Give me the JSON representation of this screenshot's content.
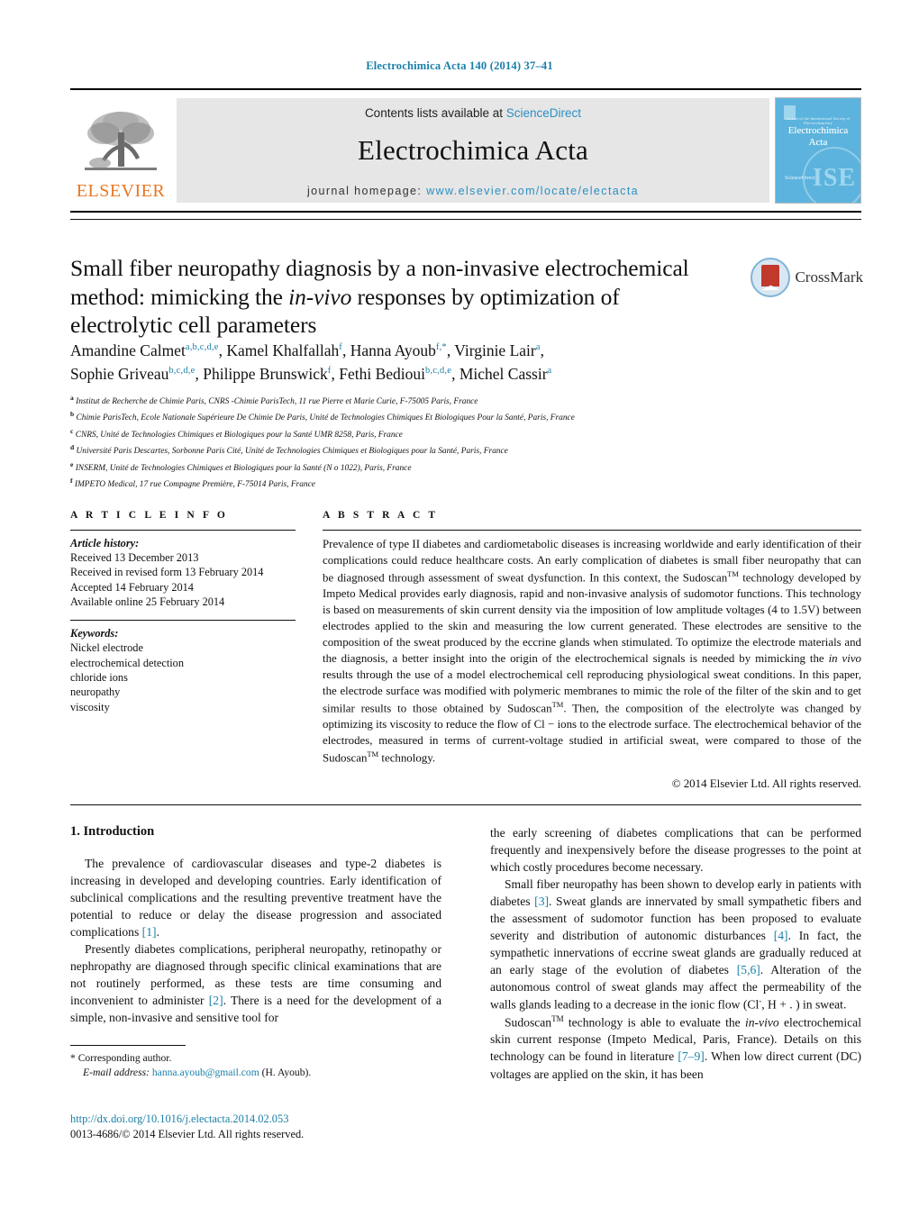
{
  "running_head": "Electrochimica Acta 140 (2014) 37–41",
  "masthead": {
    "publisher_name": "ELSEVIER",
    "contents_prefix": "Contents lists available at ",
    "contents_link": "ScienceDirect",
    "journal_title": "Electrochimica Acta",
    "homepage_label": "journal homepage:",
    "homepage_url": "www.elsevier.com/locate/electacta",
    "cover_title_line1": "Electrochimica",
    "cover_title_line2": "Acta",
    "cover_tagline": "Journal of the International Society of Electrochemistry",
    "cover_sciencedirect": "ScienceDirect",
    "cover_society": "ISE",
    "accent_color": "#2b8fc4",
    "elsevier_orange": "#E87722",
    "cover_blue": "#5cb3dd"
  },
  "article": {
    "title_line1": "Small fiber neuropathy diagnosis by a non-invasive electrochemical",
    "title_line2_a": "method: mimicking the ",
    "title_line2_italic": "in-vivo",
    "title_line2_b": " responses by optimization of",
    "title_line3": "electrolytic cell parameters",
    "crossmark_label": "CrossMark",
    "authors_line1": [
      {
        "name": "Amandine Calmet",
        "sup": "a,b,c,d,e"
      },
      {
        "name": "Kamel Khalfallah",
        "sup": "f"
      },
      {
        "name": "Hanna Ayoub",
        "sup": "f,*"
      },
      {
        "name": "Virginie Lair",
        "sup": "a"
      }
    ],
    "authors_line2": [
      {
        "name": "Sophie Griveau",
        "sup": "b,c,d,e"
      },
      {
        "name": "Philippe Brunswick",
        "sup": "f"
      },
      {
        "name": "Fethi Bedioui",
        "sup": "b,c,d,e"
      },
      {
        "name": "Michel Cassir",
        "sup": "a"
      }
    ],
    "affiliations": [
      {
        "mark": "a",
        "text": "Institut de Recherche de Chimie Paris, CNRS -Chimie ParisTech, 11 rue Pierre et Marie Curie, F-75005 Paris, France"
      },
      {
        "mark": "b",
        "text": "Chimie ParisTech, Ecole Nationale Supérieure De Chimie De Paris, Unité de Technologies Chimiques Et Biologiques Pour la Santé, Paris, France"
      },
      {
        "mark": "c",
        "text": "CNRS, Unité de Technologies Chimiques et Biologiques pour la Santé UMR 8258, Paris, France"
      },
      {
        "mark": "d",
        "text": "Université Paris Descartes, Sorbonne Paris Cité, Unité de Technologies Chimiques et Biologiques pour la Santé, Paris, France"
      },
      {
        "mark": "e",
        "text": "INSERM, Unité de Technologies Chimiques et Biologiques pour la Santé (N o 1022), Paris, France"
      },
      {
        "mark": "f",
        "text": "IMPETO Medical, 17 rue Compagne Première, F-75014 Paris, France"
      }
    ]
  },
  "article_info": {
    "heading": "A R T I C L E   I N F O",
    "history_label": "Article history:",
    "history": [
      "Received 13 December 2013",
      "Received in revised form 13 February 2014",
      "Accepted 14 February 2014",
      "Available online 25 February 2014"
    ],
    "keywords_label": "Keywords:",
    "keywords": [
      "Nickel electrode",
      "electrochemical detection",
      "chloride ions",
      "neuropathy",
      "viscosity"
    ]
  },
  "abstract": {
    "heading": "A B S T R A C T",
    "p1": "Prevalence of type II diabetes and cardiometabolic diseases is increasing worldwide and early identification of their complications could reduce healthcare costs. An early complication of diabetes is small fiber neuropathy that can be diagnosed through assessment of sweat dysfunction. In this context, the Sudoscan",
    "tm1": "TM",
    "p2": " technology developed by Impeto Medical provides early diagnosis, rapid and non-invasive analysis of sudomotor functions. This technology is based on measurements of skin current density via the imposition of low amplitude voltages (4 to 1.5V) between electrodes applied to the skin and measuring the low current generated. These electrodes are sensitive to the composition of the sweat produced by the eccrine glands when stimulated. To optimize the electrode materials and the diagnosis, a better insight into the origin of the electrochemical signals is needed by mimicking the ",
    "italic1": "in vivo",
    "p3": " results through the use of a model electrochemical cell reproducing physiological sweat conditions. In this paper, the electrode surface was modified with polymeric membranes to mimic the role of the filter of the skin and to get similar results to those obtained by Sudoscan",
    "tm2": "TM",
    "p4": ". Then, the composition of the electrolyte was changed by optimizing its viscosity to reduce the flow of Cl − ions to the electrode surface. The electrochemical behavior of the electrodes, measured in terms of current-voltage studied in artificial sweat, were compared to those of the Sudoscan",
    "tm3": "TM",
    "p5": " technology.",
    "copyright": "© 2014 Elsevier Ltd. All rights reserved."
  },
  "introduction": {
    "heading": "1.  Introduction",
    "left_p1_a": "The prevalence of cardiovascular diseases and type-2 diabetes is increasing in developed and developing countries. Early identification of subclinical complications and the resulting preventive treatment have the potential to reduce or delay the disease progression and associated complications ",
    "left_p1_ref": "[1]",
    "left_p1_b": ".",
    "left_p2_a": "Presently diabetes complications, peripheral neuropathy, retinopathy or nephropathy are diagnosed through specific clinical examinations that are not routinely performed, as these tests are time consuming and inconvenient to administer ",
    "left_p2_ref": "[2]",
    "left_p2_b": ". There is a need for the development of a simple, non-invasive and sensitive tool for",
    "right_p1": "the early screening of diabetes complications that can be performed frequently and inexpensively before the disease progresses to the point at which costly procedures become necessary.",
    "right_p2_a": "Small fiber neuropathy has been shown to develop early in patients with diabetes ",
    "right_p2_ref1": "[3]",
    "right_p2_b": ". Sweat glands are innervated by small sympathetic fibers and the assessment of sudomotor function has been proposed to evaluate severity and distribution of autonomic disturbances ",
    "right_p2_ref2": "[4]",
    "right_p2_c": ". In fact, the sympathetic innervations of eccrine sweat glands are gradually reduced at an early stage of the evolution of diabetes ",
    "right_p2_ref3": "[5,6]",
    "right_p2_d": ". Alteration of the autonomous control of sweat glands may affect the permeability of the walls glands leading to a decrease in the ionic flow (Cl",
    "right_p2_sup": "-",
    "right_p2_e": ", H + . ) in sweat.",
    "right_p3_a": "Sudoscan",
    "right_p3_tm": "TM",
    "right_p3_b": " technology is able to evaluate the ",
    "right_p3_italic": "in-vivo",
    "right_p3_c": " electrochemical skin current response (Impeto Medical, Paris, France). Details on this technology can be found in literature ",
    "right_p3_ref": "[7–9]",
    "right_p3_d": ". When low direct current (DC) voltages are applied on the skin, it has been"
  },
  "footnotes": {
    "corresponding_marker": "*",
    "corresponding_label": "Corresponding author.",
    "email_label": "E-mail address:",
    "email": "hanna.ayoub@gmail.com",
    "email_owner": "(H. Ayoub).",
    "doi": "http://dx.doi.org/10.1016/j.electacta.2014.02.053",
    "issn_line": "0013-4686/© 2014 Elsevier Ltd. All rights reserved."
  }
}
